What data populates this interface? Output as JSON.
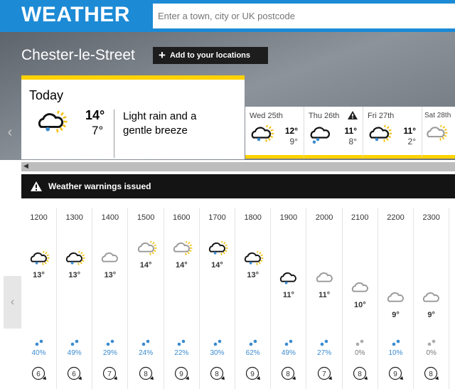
{
  "header": {
    "logo": "WEATHER",
    "search_placeholder": "Enter a town, city or UK postcode"
  },
  "location": {
    "name": "Chester-le-Street",
    "add_label": "Add to your locations"
  },
  "today": {
    "label": "Today",
    "high": "14°",
    "low": "7°",
    "description": "Light rain and a gentle breeze",
    "icon": "light-rain-sunny-intervals"
  },
  "days": [
    {
      "name": "Wed 25th",
      "high": "12°",
      "low": "9°",
      "icon": "light-rain-sunny-intervals",
      "warning": false
    },
    {
      "name": "Thu 26th",
      "high": "11°",
      "low": "8°",
      "icon": "heavy-rain",
      "warning": true
    },
    {
      "name": "Fri 27th",
      "high": "11°",
      "low": "2°",
      "icon": "light-rain-sunny-intervals",
      "warning": false
    },
    {
      "name": "Sat 28th",
      "high": "",
      "low": "",
      "icon": "sunny-intervals",
      "warning": false
    }
  ],
  "warnings": {
    "label": "Weather warnings issued"
  },
  "hours": [
    {
      "time": "1200",
      "temp": 13,
      "icon": "light-rain-sun",
      "rain": "40%",
      "wind": "6"
    },
    {
      "time": "1300",
      "temp": 13,
      "icon": "light-rain-sun",
      "rain": "49%",
      "wind": "6"
    },
    {
      "time": "1400",
      "temp": 13,
      "icon": "light-cloud",
      "rain": "29%",
      "wind": "7"
    },
    {
      "time": "1500",
      "temp": 14,
      "icon": "sunny-intervals",
      "rain": "24%",
      "wind": "8"
    },
    {
      "time": "1600",
      "temp": 14,
      "icon": "sunny-intervals",
      "rain": "22%",
      "wind": "9"
    },
    {
      "time": "1700",
      "temp": 14,
      "icon": "light-rain-sun",
      "rain": "30%",
      "wind": "8"
    },
    {
      "time": "1800",
      "temp": 13,
      "icon": "light-rain-sun",
      "rain": "62%",
      "wind": "9"
    },
    {
      "time": "1900",
      "temp": 11,
      "icon": "light-rain",
      "rain": "49%",
      "wind": "8"
    },
    {
      "time": "2000",
      "temp": 11,
      "icon": "cloud-moon",
      "rain": "27%",
      "wind": "7"
    },
    {
      "time": "2100",
      "temp": 10,
      "icon": "cloud-moon",
      "rain": "0%",
      "wind": "8"
    },
    {
      "time": "2200",
      "temp": 9,
      "icon": "cloud-moon",
      "rain": "10%",
      "wind": "9"
    },
    {
      "time": "2300",
      "temp": 9,
      "icon": "light-cloud",
      "rain": "0%",
      "wind": "8"
    }
  ],
  "colors": {
    "brand": "#1c8ad5",
    "accent": "#ffd200",
    "rain": "#3a8bcf"
  }
}
